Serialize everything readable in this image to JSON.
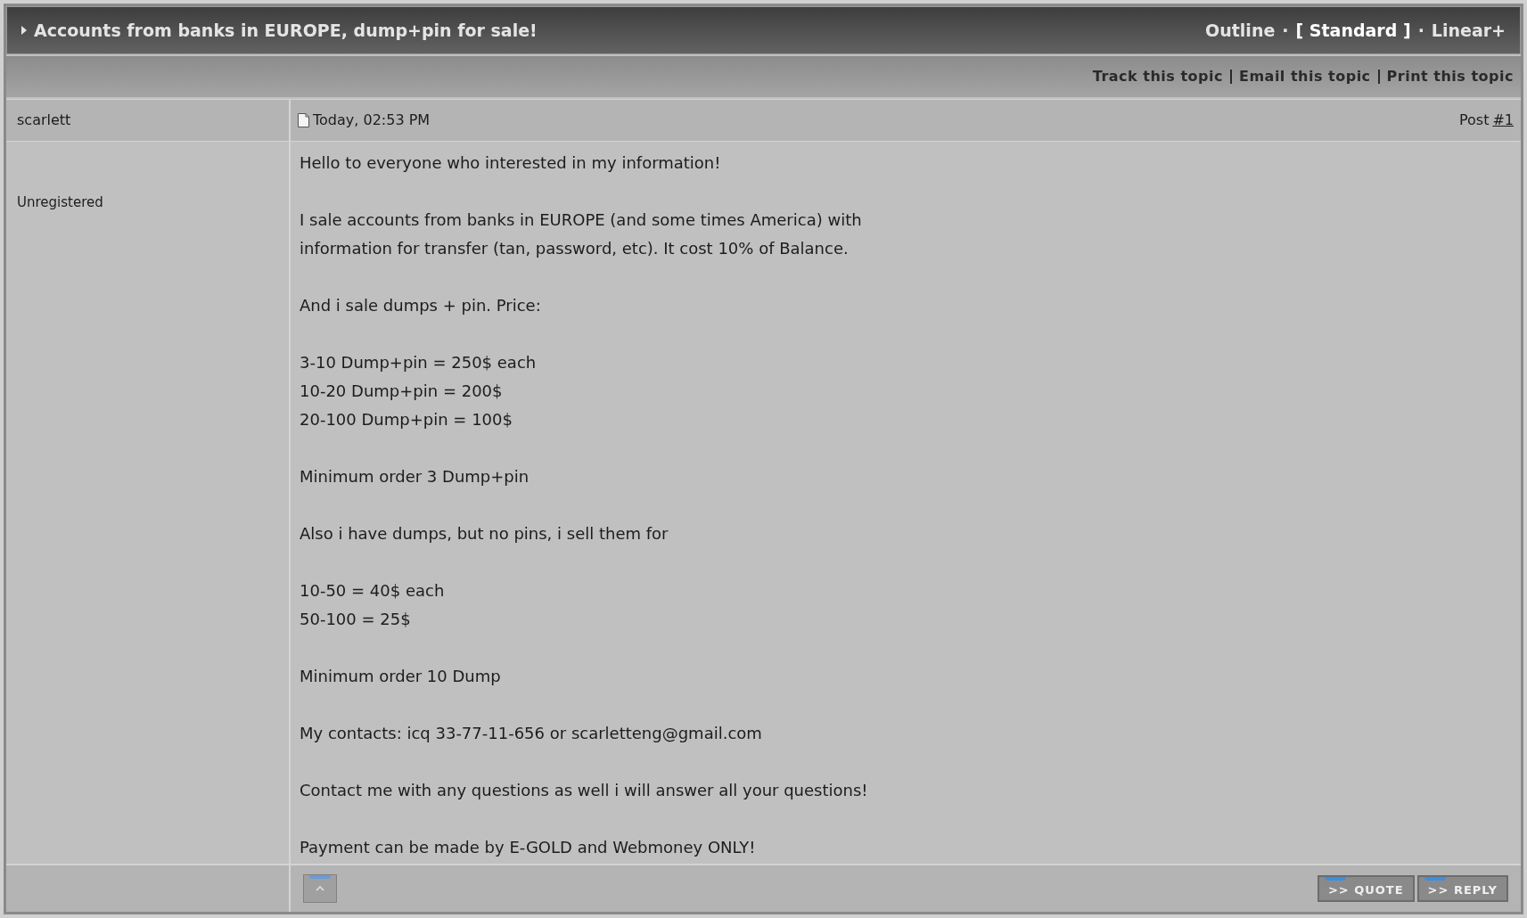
{
  "topic": {
    "title": "Accounts from banks in EUROPE, dump+pin for sale!",
    "mode_separator": "·",
    "selected_marks": [
      "[",
      "]"
    ],
    "view_modes": [
      {
        "label": "Outline",
        "selected": false
      },
      {
        "label": "Standard",
        "selected": true
      },
      {
        "label": "Linear+",
        "selected": false
      }
    ]
  },
  "topic_actions": [
    "Track this topic",
    "Email this topic",
    "Print this topic"
  ],
  "post": {
    "author": "scarlett",
    "member_group": "Unregistered",
    "date": "Today, 02:53 PM",
    "post_label": "Post",
    "post_number": "#1",
    "paragraphs": [
      [
        "Hello to everyone who interested in my information!"
      ],
      [
        "I sale accounts from banks in EUROPE (and some times America) with",
        "information for transfer (tan, password, etc). It cost 10% of Balance."
      ],
      [
        "And i sale dumps + pin. Price:"
      ],
      [
        "3-10 Dump+pin = 250$ each",
        "10-20 Dump+pin = 200$",
        "20-100 Dump+pin = 100$"
      ],
      [
        "Minimum order 3 Dump+pin"
      ],
      [
        "Also i have dumps, but no pins, i sell them for"
      ],
      [
        "10-50 = 40$ each",
        "50-100 = 25$"
      ],
      [
        "Minimum order 10 Dump"
      ],
      [
        "My contacts: icq 33-77-11-656 or scarletteng@gmail.com"
      ],
      [
        "Contact me with any questions as well i will answer all your questions!"
      ],
      [
        "Payment can be made by E-GOLD and Webmoney ONLY!"
      ]
    ],
    "buttons": [
      ">> QUOTE",
      ">> REPLY"
    ]
  }
}
